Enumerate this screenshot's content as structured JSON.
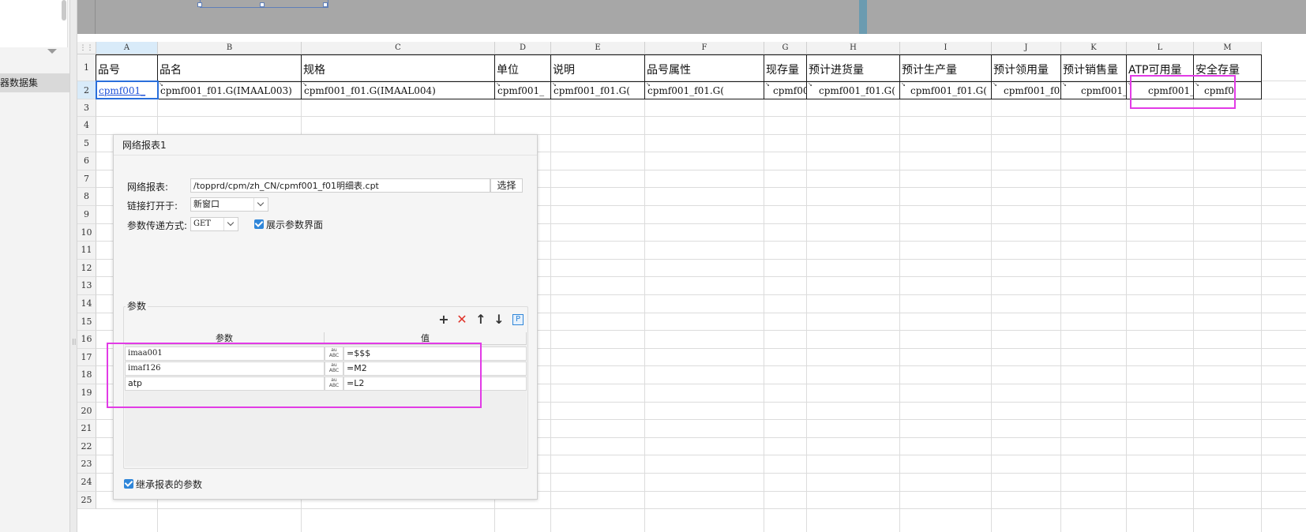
{
  "left_panel": {
    "dataset_label": "器数据集"
  },
  "sheet": {
    "columns": [
      "A",
      "B",
      "C",
      "D",
      "E",
      "F",
      "G",
      "H",
      "I",
      "J",
      "K",
      "L",
      "M"
    ],
    "rows": [
      "1",
      "2",
      "3",
      "4",
      "5",
      "6",
      "7",
      "8",
      "9",
      "10",
      "11",
      "12",
      "13",
      "14",
      "15",
      "16",
      "17",
      "18",
      "19",
      "20",
      "21",
      "22",
      "23",
      "24",
      "25"
    ],
    "header_cells": [
      "品号",
      "品名",
      "规格",
      "单位",
      "说明",
      "品号属性",
      "现存量",
      "预计进货量",
      "预计生产量",
      "预计领用量",
      "预计销售量",
      "ATP可用量",
      "安全存量"
    ],
    "data_cells": [
      "cpmf001_",
      "cpmf001_f01.G(IMAAL003)",
      "cpmf001_f01.G(IMAAL004)",
      "cpmf001_",
      "cpmf001_f01.G(",
      "cpmf001_f01.G(",
      "cpmf00",
      "cpmf001_f01.G(",
      "cpmf001_f01.G(",
      "cpmf001_f0",
      "cpmf001_",
      "cpmf001_",
      "cpmf0"
    ]
  },
  "dialog": {
    "title": "网络报表1",
    "report_label": "网络报表:",
    "report_path": "/topprd/cpm/zh_CN/cpmf001_f01明细表.cpt",
    "select_button": "选择",
    "open_in_label": "链接打开于:",
    "open_in_value": "新窗口",
    "method_label": "参数传递方式:",
    "method_value": "GET",
    "show_params_label": "展示参数界面",
    "params_group_label": "参数",
    "table_headers": {
      "name": "参数",
      "value": "值"
    },
    "params": [
      {
        "name": "imaa001",
        "value": "=$$$"
      },
      {
        "name": "imaf126",
        "value": "=M2"
      },
      {
        "name": "atp",
        "value": "=L2"
      }
    ],
    "type_icon_text": "ABC",
    "p_button": "P",
    "inherit_label": "继承报表的参数"
  },
  "colors": {
    "highlight": "#e23be6",
    "accent": "#2f86d9",
    "selection": "#2a6fdb"
  },
  "icons": [
    "add-icon",
    "delete-icon",
    "move-up-icon",
    "move-down-icon",
    "param-p-icon",
    "chevron-down-icon",
    "checkbox-checked-icon",
    "text-type-icon"
  ]
}
